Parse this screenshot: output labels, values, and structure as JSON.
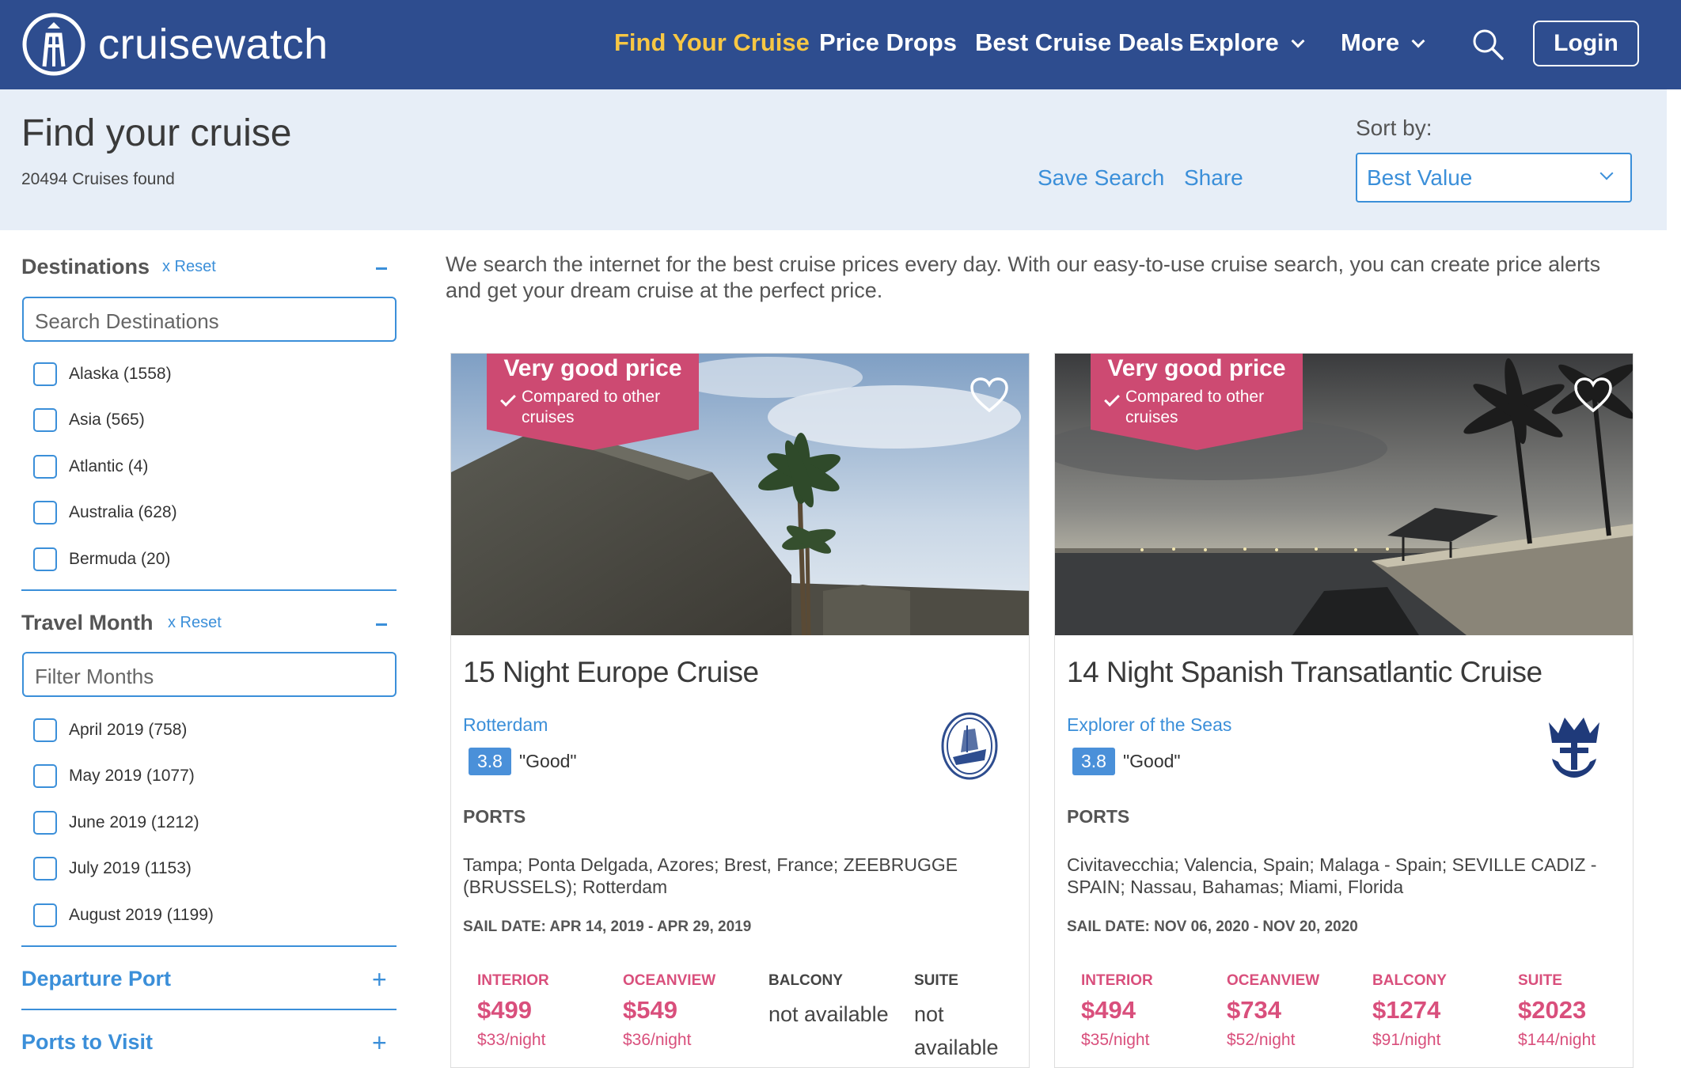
{
  "header": {
    "brand": "cruisewatch",
    "nav": {
      "find_your_cruise": "Find Your Cruise",
      "price_drops": "Price Drops",
      "best_cruise_deals": "Best Cruise Deals",
      "explore": "Explore",
      "more": "More"
    },
    "login": "Login",
    "colors": {
      "bar": "#2e4d8f",
      "active": "#f7c744"
    }
  },
  "subheader": {
    "title": "Find your cruise",
    "count": "20494 Cruises found",
    "save_search": "Save Search",
    "share": "Share",
    "sort_label": "Sort by:",
    "sort_value": "Best Value"
  },
  "sidebar": {
    "destinations": {
      "title": "Destinations",
      "reset": "x  Reset",
      "placeholder": "Search Destinations",
      "options": [
        "Alaska (1558)",
        "Asia (565)",
        "Atlantic (4)",
        "Australia (628)",
        "Bermuda (20)"
      ]
    },
    "travel_month": {
      "title": "Travel Month",
      "reset": "x  Reset",
      "placeholder": "Filter Months",
      "options": [
        "April 2019 (758)",
        "May 2019 (1077)",
        "June 2019 (1212)",
        "July 2019 (1153)",
        "August 2019 (1199)"
      ]
    },
    "departure_port": "Departure Port",
    "ports_to_visit": "Ports to Visit"
  },
  "intro": "We search the internet for the best cruise prices every day. With our easy-to-use cruise search, you can create price alerts and get your dream cruise at the perfect price.",
  "cards": [
    {
      "badge_title": "Very good price",
      "badge_sub": "Compared to other cruises",
      "title": "15 Night Europe Cruise",
      "ship": "Rotterdam",
      "rating": "3.8",
      "rating_text": "\"Good\"",
      "ports_label": "PORTS",
      "ports": "Tampa; Ponta Delgada, Azores; Brest, France; ZEEBRUGGE (BRUSSELS); Rotterdam",
      "sail_date": "SAIL DATE:  APR 14, 2019   -   APR 29, 2019",
      "prices": {
        "interior": {
          "label": "INTERIOR",
          "price": "$499",
          "night": "$33/night"
        },
        "oceanview": {
          "label": "OCEANVIEW",
          "price": "$549",
          "night": "$36/night"
        },
        "balcony": {
          "label": "BALCONY",
          "na": "not available"
        },
        "suite": {
          "label": "SUITE",
          "na": "not available"
        }
      }
    },
    {
      "badge_title": "Very good price",
      "badge_sub": "Compared to other cruises",
      "title": "14 Night Spanish Transatlantic Cruise",
      "ship": "Explorer of the Seas",
      "rating": "3.8",
      "rating_text": "\"Good\"",
      "ports_label": "PORTS",
      "ports": "Civitavecchia; Valencia, Spain; Malaga - Spain; SEVILLE CADIZ - SPAIN; Nassau, Bahamas; Miami, Florida",
      "sail_date": "SAIL DATE:  NOV 06, 2020   -   NOV 20, 2020",
      "prices": {
        "interior": {
          "label": "INTERIOR",
          "price": "$494",
          "night": "$35/night"
        },
        "oceanview": {
          "label": "OCEANVIEW",
          "price": "$734",
          "night": "$52/night"
        },
        "balcony": {
          "label": "BALCONY",
          "price": "$1274",
          "night": "$91/night"
        },
        "suite": {
          "label": "SUITE",
          "price": "$2023",
          "night": "$144/night"
        }
      }
    }
  ]
}
